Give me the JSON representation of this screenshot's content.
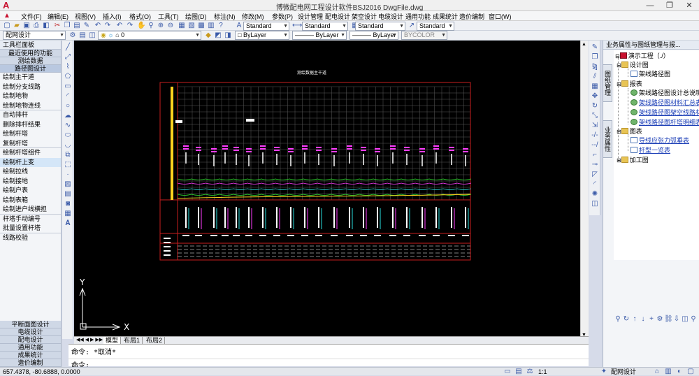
{
  "window": {
    "title": "博微配电网工程设计软件BSJ2016    DwgFile.dwg",
    "app_icon": "A",
    "controls": [
      "—",
      "❐",
      "✕"
    ]
  },
  "menu": [
    "文件(F)",
    "编辑(E)",
    "视图(V)",
    "插入(I)",
    "格式(O)",
    "工具(T)",
    "绘图(D)",
    "标注(N)",
    "修改(M)",
    "参数(P)",
    "设计管理",
    "配电设计",
    "架空设计",
    "电缆设计",
    "通用功能",
    "成果统计",
    "造价编制",
    "窗口(W)"
  ],
  "toolbar": {
    "style_combos": [
      "Standard",
      "Standard",
      "Standard",
      "Standard"
    ],
    "workspace": "配网设计",
    "layer": "0",
    "color": "ByLayer",
    "linetype": "ByLayer",
    "lineweight": "ByLayer",
    "plotstyle": "BYCOLOR"
  },
  "left_panel": {
    "title": "工具栏面板",
    "top_sections": [
      "最近使用的功能",
      "测绘数据",
      "路径图设计"
    ],
    "items": [
      {
        "label": "绘制主干道",
        "sep": false
      },
      {
        "label": "绘制分支线路",
        "sep": false
      },
      {
        "label": "绘制地物",
        "sep": false
      },
      {
        "label": "绘制地物连线",
        "sep": true
      },
      {
        "label": "自动排杆",
        "sep": false
      },
      {
        "label": "删除排杆结果",
        "sep": false
      },
      {
        "label": "绘制杆塔",
        "sep": false
      },
      {
        "label": "复制杆塔",
        "sep": true
      },
      {
        "label": "绘制杆塔组件",
        "sep": false
      },
      {
        "label": "绘制杆上变",
        "sep": false
      },
      {
        "label": "绘制拉线",
        "sep": false
      },
      {
        "label": "绘制接地",
        "sep": false
      },
      {
        "label": "绘制户表",
        "sep": false
      },
      {
        "label": "绘制表箱",
        "sep": false
      },
      {
        "label": "绘制进户线横担",
        "sep": true
      },
      {
        "label": "杆塔手动编号",
        "sep": false
      },
      {
        "label": "批量设置杆塔",
        "sep": true
      },
      {
        "label": "线路校验",
        "sep": false
      }
    ],
    "selected_index": 9,
    "bottom_sections": [
      "平断面图设计",
      "电缆设计",
      "配电设计",
      "通用功能",
      "成果统计",
      "造价编制"
    ]
  },
  "drawing": {
    "title": "测绘数据主干道",
    "ucs_x": "X",
    "ucs_y": "Y"
  },
  "tabs": [
    "模型",
    "布局1",
    "布局2"
  ],
  "command": {
    "line1": "命令: *取消*",
    "line2": "命令:"
  },
  "status": {
    "coords": "657.4378,  -80.6888,  0.0000",
    "scale": "1:1",
    "workspace": "配网设计"
  },
  "right_panel": {
    "title": "业务属性与图纸管理与报...",
    "vtabs": [
      "图纸管理",
      "业务属性"
    ],
    "tree": {
      "root": "演示工程（./）",
      "design_folder": "设计图",
      "design_item": "架线路径图",
      "report_folder": "报表",
      "report_items": [
        "架线路径图设计总说明",
        "架线路径图材料汇总表",
        "架线路径图架空线路材...",
        "架线路径图杆塔明细表"
      ],
      "chart_folder": "图表",
      "chart_items": [
        "导线应张力弧垂表",
        "杆型一览表"
      ],
      "process_folder": "加工图"
    }
  },
  "colors": {
    "canvas": "#000000",
    "frame": "#c81e1e",
    "grid": "#5a5a5a",
    "magenta": "#ff3cff",
    "yellow": "#ffd21e",
    "green": "#32e632",
    "cyan": "#28dcdc"
  },
  "icons": [
    "app-logo-icon",
    "new-file-icon",
    "open-icon",
    "save-icon",
    "print-icon",
    "undo-icon",
    "redo-icon",
    "pan-icon",
    "zoom-icon",
    "line-icon",
    "circle-icon",
    "arc-icon",
    "text-icon",
    "folder-icon",
    "document-icon",
    "ucs-icon"
  ]
}
